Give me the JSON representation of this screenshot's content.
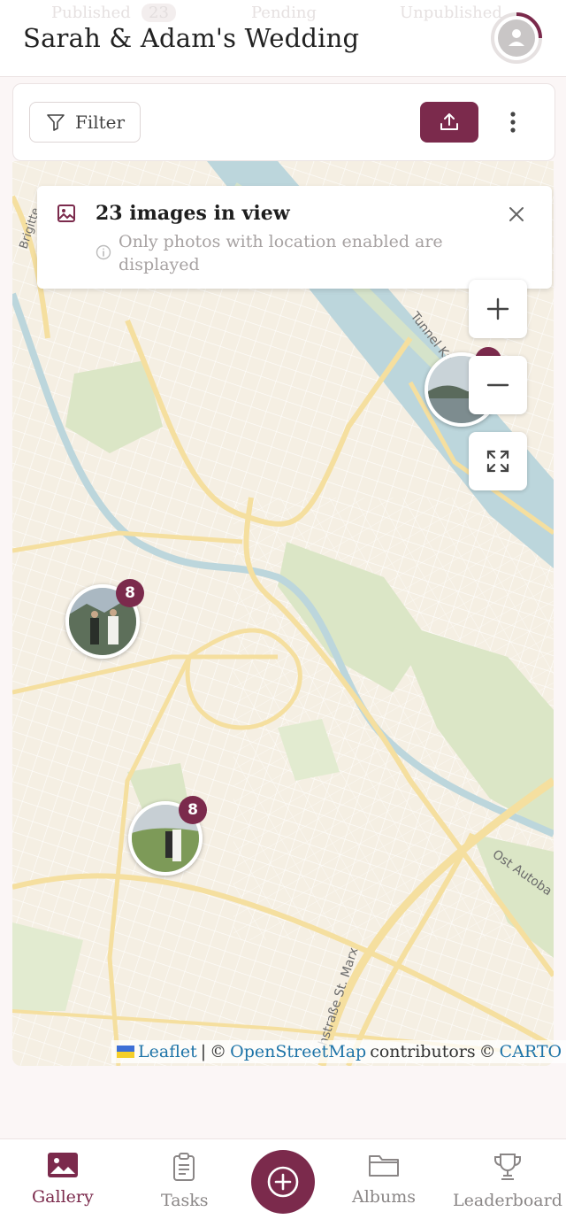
{
  "header": {
    "title": "Sarah & Adam's Wedding",
    "tabs_behind": [
      {
        "label": "Published",
        "count": "23"
      },
      {
        "label": "Pending"
      },
      {
        "label": "Unpublished"
      }
    ]
  },
  "toolbar": {
    "filter_label": "Filter"
  },
  "map": {
    "info_card": {
      "title": "23 images in view",
      "subtitle": "Only photos with location enabled are displayed"
    },
    "clusters": [
      {
        "count": "8"
      },
      {
        "count": "8"
      }
    ],
    "street_labels": [
      "Tunnel Ka",
      "Ost Autoba",
      "hstraße St. Marx",
      "Brigitte"
    ],
    "attribution": {
      "leaflet": "Leaflet",
      "separator": "|",
      "copy1": "©",
      "osm": "OpenStreetMap",
      "contributors": "contributors",
      "copy2": "©",
      "carto": "CARTO"
    }
  },
  "bottom_nav": {
    "items": [
      {
        "label": "Gallery",
        "icon": "image-icon",
        "active": true
      },
      {
        "label": "Tasks",
        "icon": "clipboard-icon"
      },
      {
        "label": "Albums",
        "icon": "folder-icon"
      },
      {
        "label": "Leaderboard",
        "icon": "trophy-icon"
      }
    ]
  },
  "colors": {
    "accent": "#7b2a4c",
    "water": "#bcd6dc",
    "park": "#dbe6c6",
    "road": "#f5df9f"
  }
}
